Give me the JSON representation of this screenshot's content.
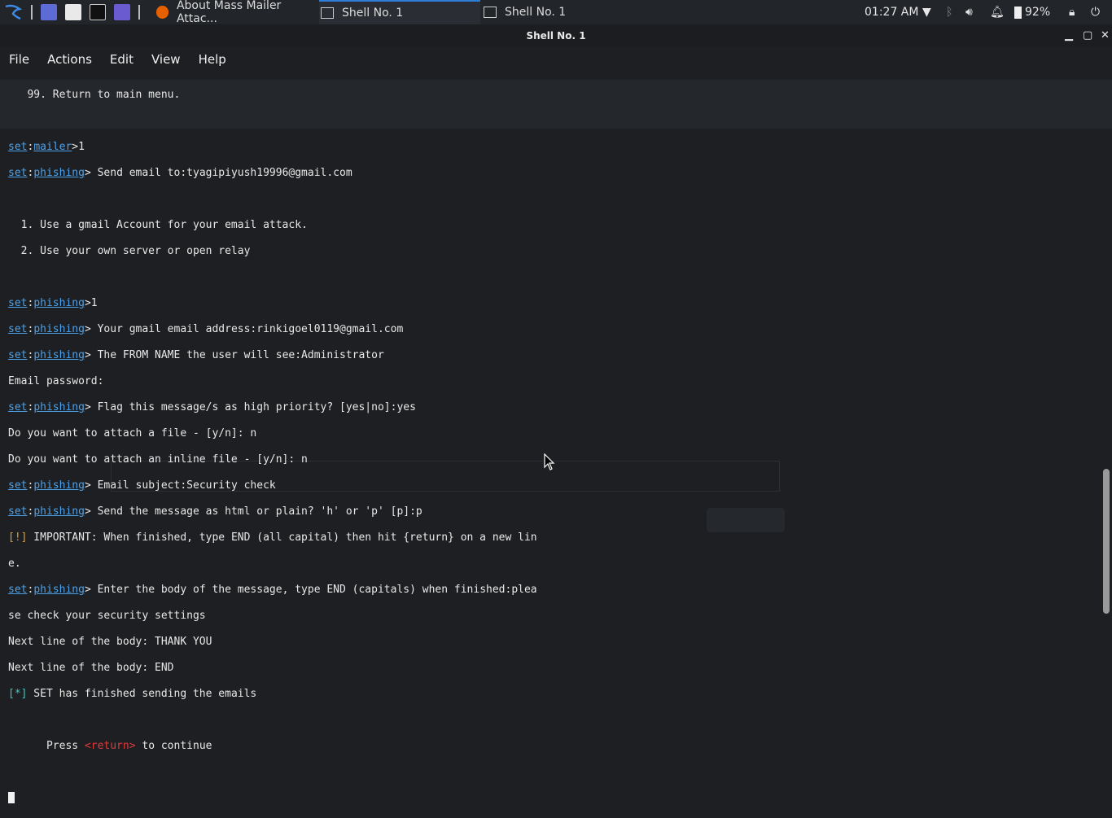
{
  "panel": {
    "tasks": [
      {
        "label": "About Mass Mailer Attac...",
        "icon": "firefox-icon"
      },
      {
        "label": "Shell No. 1",
        "icon": "terminal-icon"
      },
      {
        "label": "Shell No. 1",
        "icon": "terminal-icon"
      }
    ],
    "clock": "01:27 AM",
    "battery": "92%"
  },
  "window": {
    "title": "Shell No. 1"
  },
  "menubar": [
    "File",
    "Actions",
    "Edit",
    "View",
    "Help"
  ],
  "terminal": {
    "return_line": "   99. Return to main menu.",
    "prompt_set": "set",
    "prompt_mailer": "mailer",
    "prompt_phishing": "phishing",
    "lines": {
      "mailer_input": ">1",
      "send_to": "> Send email to:tyagipiyush19996@gmail.com",
      "opt1": "  1. Use a gmail Account for your email attack.",
      "opt2": "  2. Use your own server or open relay",
      "phishing_input": ">1",
      "gmail_addr": "> Your gmail email address:rinkigoel0119@gmail.com",
      "from_name": "> The FROM NAME the user will see:Administrator",
      "password": "Email password:",
      "priority": "> Flag this message/s as high priority? [yes|no]:yes",
      "attach_file": "Do you want to attach a file - [y/n]: n",
      "attach_inline": "Do you want to attach an inline file - [y/n]: n",
      "subject": "> Email subject:Security check",
      "html_plain": "> Send the message as html or plain? 'h' or 'p' [p]:p",
      "important_tag": "[!]",
      "important": " IMPORTANT: When finished, type END (all capital) then hit {return} on a new lin",
      "important_wrap": "e.",
      "body_prompt": "> Enter the body of the message, type END (capitals) when finished:plea",
      "body_wrap": "se check your security settings",
      "next1": "Next line of the body: THANK YOU",
      "next2": "Next line of the body: END",
      "done_tag": "[*]",
      "done": " SET has finished sending the emails",
      "press_pre": "      Press ",
      "press_key": "<return>",
      "press_post": " to continue"
    }
  }
}
